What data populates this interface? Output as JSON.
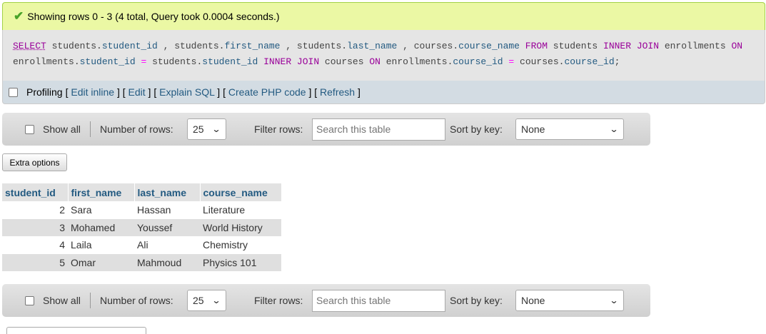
{
  "status": {
    "message": "Showing rows 0 - 3 (4 total, Query took 0.0004 seconds.)",
    "icon": "check-icon"
  },
  "sql": {
    "line1": [
      {
        "t": "SELECT",
        "c": "kw-u"
      },
      {
        "t": " students.",
        "c": "tbl"
      },
      {
        "t": "student_id",
        "c": "col"
      },
      {
        "t": " , students.",
        "c": "tbl"
      },
      {
        "t": "first_name",
        "c": "col"
      },
      {
        "t": " , students.",
        "c": "tbl"
      },
      {
        "t": "last_name",
        "c": "col"
      },
      {
        "t": " , courses.",
        "c": "tbl"
      },
      {
        "t": "course_name",
        "c": "col"
      },
      {
        "t": " FROM",
        "c": "kw"
      },
      {
        "t": " students ",
        "c": "tbl"
      },
      {
        "t": "INNER JOIN",
        "c": "kw"
      },
      {
        "t": " enrollments ",
        "c": "tbl"
      },
      {
        "t": "ON",
        "c": "kw"
      }
    ],
    "line2": [
      {
        "t": "enrollments.",
        "c": "tbl"
      },
      {
        "t": "student_id",
        "c": "col"
      },
      {
        "t": " ",
        "c": "tbl"
      },
      {
        "t": "=",
        "c": "op"
      },
      {
        "t": " students.",
        "c": "tbl"
      },
      {
        "t": "student_id",
        "c": "col"
      },
      {
        "t": " ",
        "c": "tbl"
      },
      {
        "t": "INNER JOIN",
        "c": "kw"
      },
      {
        "t": " courses ",
        "c": "tbl"
      },
      {
        "t": "ON",
        "c": "kw"
      },
      {
        "t": " enrollments.",
        "c": "tbl"
      },
      {
        "t": "course_id",
        "c": "col"
      },
      {
        "t": " ",
        "c": "tbl"
      },
      {
        "t": "=",
        "c": "op"
      },
      {
        "t": " courses.",
        "c": "tbl"
      },
      {
        "t": "course_id",
        "c": "col"
      },
      {
        "t": ";",
        "c": "tbl"
      }
    ]
  },
  "profiling": {
    "label": "Profiling",
    "links": [
      "Edit inline",
      "Edit",
      "Explain SQL",
      "Create PHP code",
      "Refresh"
    ]
  },
  "nav": {
    "show_all": "Show all",
    "num_rows_label": "Number of rows:",
    "num_rows_value": "25",
    "filter_label": "Filter rows:",
    "filter_placeholder": "Search this table",
    "sort_label": "Sort by key:",
    "sort_value": "None"
  },
  "extra_options": "Extra options",
  "table": {
    "headers": [
      "student_id",
      "first_name",
      "last_name",
      "course_name"
    ],
    "rows": [
      [
        "2",
        "Sara",
        "Hassan",
        "Literature"
      ],
      [
        "3",
        "Mohamed",
        "Youssef",
        "World History"
      ],
      [
        "4",
        "Laila",
        "Ali",
        "Chemistry"
      ],
      [
        "5",
        "Omar",
        "Mahmoud",
        "Physics 101"
      ]
    ]
  }
}
